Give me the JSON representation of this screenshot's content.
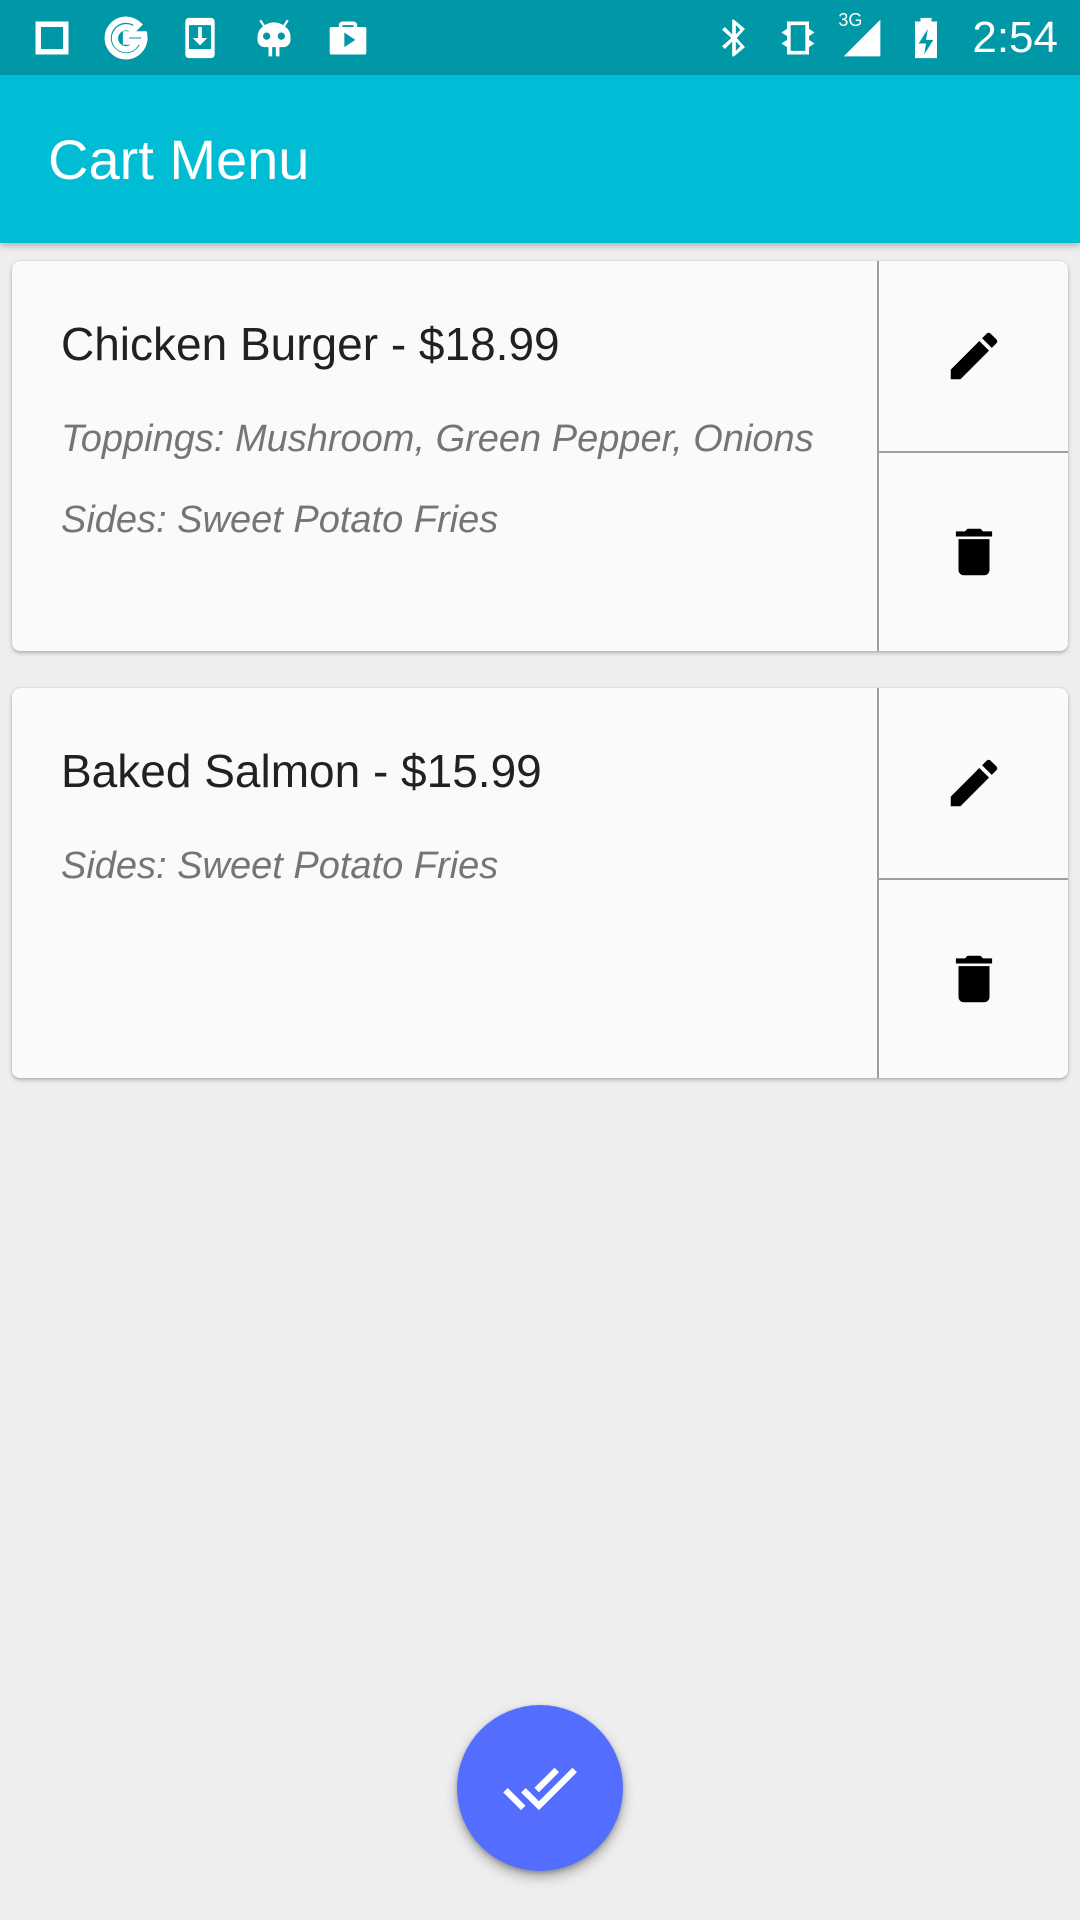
{
  "status_bar": {
    "time": "2:54",
    "network_label": "3G",
    "left_icons": [
      "square-icon",
      "google-icon",
      "download-icon",
      "android-icon",
      "briefcase-play-icon"
    ],
    "right_icons": [
      "bluetooth-icon",
      "vibrate-icon",
      "signal-icon",
      "battery-charging-icon"
    ]
  },
  "app_bar": {
    "title": "Cart Menu"
  },
  "cart_items": [
    {
      "title": "Chicken Burger - $18.99",
      "details": [
        "Toppings: Mushroom, Green Pepper, Onions",
        "Sides: Sweet Potato Fries"
      ]
    },
    {
      "title": "Baked Salmon - $15.99",
      "details": [
        "Sides: Sweet Potato Fries"
      ]
    }
  ],
  "fab": {
    "icon": "double-check-icon"
  },
  "colors": {
    "status_bar": "#0097a7",
    "app_bar": "#00bcd4",
    "fab": "#536dfe",
    "background": "#eeeeef",
    "card": "#fafafa"
  }
}
